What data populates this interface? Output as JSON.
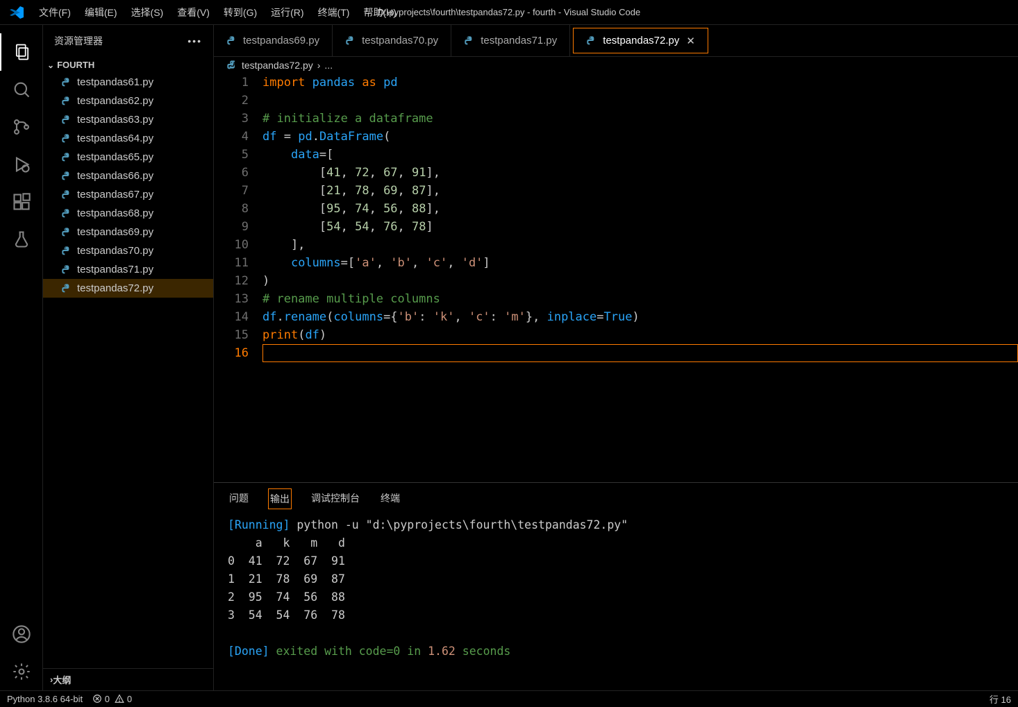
{
  "window_title": "D:\\pyprojects\\fourth\\testpandas72.py - fourth - Visual Studio Code",
  "menu": [
    "文件(F)",
    "编辑(E)",
    "选择(S)",
    "查看(V)",
    "转到(G)",
    "运行(R)",
    "终端(T)",
    "帮助(H)"
  ],
  "sidebar": {
    "header": "资源管理器",
    "section": "FOURTH",
    "outline": "大纲",
    "files": [
      "testpandas61.py",
      "testpandas62.py",
      "testpandas63.py",
      "testpandas64.py",
      "testpandas65.py",
      "testpandas66.py",
      "testpandas67.py",
      "testpandas68.py",
      "testpandas69.py",
      "testpandas70.py",
      "testpandas71.py",
      "testpandas72.py"
    ],
    "selected": 11
  },
  "tabs": {
    "items": [
      "testpandas69.py",
      "testpandas70.py",
      "testpandas71.py",
      "testpandas72.py"
    ],
    "active": 3
  },
  "breadcrumb": {
    "file": "testpandas72.py",
    "tail": "..."
  },
  "code": {
    "cursor_line": 16,
    "tokens": [
      [
        [
          "kw",
          "import"
        ],
        [
          "pl",
          " "
        ],
        [
          "id",
          "pandas"
        ],
        [
          "pl",
          " "
        ],
        [
          "kw",
          "as"
        ],
        [
          "pl",
          " "
        ],
        [
          "id",
          "pd"
        ]
      ],
      [],
      [
        [
          "cm",
          "# initialize a dataframe"
        ]
      ],
      [
        [
          "id",
          "df"
        ],
        [
          "pl",
          " = "
        ],
        [
          "id",
          "pd"
        ],
        [
          "pl",
          "."
        ],
        [
          "id",
          "DataFrame"
        ],
        [
          "pl",
          "("
        ]
      ],
      [
        [
          "pl",
          "    "
        ],
        [
          "id",
          "data"
        ],
        [
          "pl",
          "=["
        ]
      ],
      [
        [
          "pl",
          "        ["
        ],
        [
          "num",
          "41"
        ],
        [
          "pl",
          ", "
        ],
        [
          "num",
          "72"
        ],
        [
          "pl",
          ", "
        ],
        [
          "num",
          "67"
        ],
        [
          "pl",
          ", "
        ],
        [
          "num",
          "91"
        ],
        [
          "pl",
          "],"
        ]
      ],
      [
        [
          "pl",
          "        ["
        ],
        [
          "num",
          "21"
        ],
        [
          "pl",
          ", "
        ],
        [
          "num",
          "78"
        ],
        [
          "pl",
          ", "
        ],
        [
          "num",
          "69"
        ],
        [
          "pl",
          ", "
        ],
        [
          "num",
          "87"
        ],
        [
          "pl",
          "],"
        ]
      ],
      [
        [
          "pl",
          "        ["
        ],
        [
          "num",
          "95"
        ],
        [
          "pl",
          ", "
        ],
        [
          "num",
          "74"
        ],
        [
          "pl",
          ", "
        ],
        [
          "num",
          "56"
        ],
        [
          "pl",
          ", "
        ],
        [
          "num",
          "88"
        ],
        [
          "pl",
          "],"
        ]
      ],
      [
        [
          "pl",
          "        ["
        ],
        [
          "num",
          "54"
        ],
        [
          "pl",
          ", "
        ],
        [
          "num",
          "54"
        ],
        [
          "pl",
          ", "
        ],
        [
          "num",
          "76"
        ],
        [
          "pl",
          ", "
        ],
        [
          "num",
          "78"
        ],
        [
          "pl",
          "]"
        ]
      ],
      [
        [
          "pl",
          "    ],"
        ]
      ],
      [
        [
          "pl",
          "    "
        ],
        [
          "id",
          "columns"
        ],
        [
          "pl",
          "=["
        ],
        [
          "str",
          "'a'"
        ],
        [
          "pl",
          ", "
        ],
        [
          "str",
          "'b'"
        ],
        [
          "pl",
          ", "
        ],
        [
          "str",
          "'c'"
        ],
        [
          "pl",
          ", "
        ],
        [
          "str",
          "'d'"
        ],
        [
          "pl",
          "]"
        ]
      ],
      [
        [
          "pl",
          ")"
        ]
      ],
      [
        [
          "cm",
          "# rename multiple columns"
        ]
      ],
      [
        [
          "id",
          "df"
        ],
        [
          "pl",
          "."
        ],
        [
          "id",
          "rename"
        ],
        [
          "pl",
          "("
        ],
        [
          "id",
          "columns"
        ],
        [
          "pl",
          "={"
        ],
        [
          "str",
          "'b'"
        ],
        [
          "pl",
          ": "
        ],
        [
          "str",
          "'k'"
        ],
        [
          "pl",
          ", "
        ],
        [
          "str",
          "'c'"
        ],
        [
          "pl",
          ": "
        ],
        [
          "str",
          "'m'"
        ],
        [
          "pl",
          "}, "
        ],
        [
          "id",
          "inplace"
        ],
        [
          "pl",
          "="
        ],
        [
          "const",
          "True"
        ],
        [
          "pl",
          ")"
        ]
      ],
      [
        [
          "kw",
          "print"
        ],
        [
          "pl",
          "("
        ],
        [
          "id",
          "df"
        ],
        [
          "pl",
          ")"
        ]
      ],
      []
    ]
  },
  "panel": {
    "tabs": [
      "问题",
      "输出",
      "调试控制台",
      "终端"
    ],
    "active": 1,
    "output": {
      "running_label": "[Running]",
      "running_cmd": " python -u \"d:\\pyprojects\\fourth\\testpandas72.py\"",
      "body": "    a   k   m   d\n0  41  72  67  91\n1  21  78  69  87\n2  95  74  56  88\n3  54  54  76  78",
      "done_label": "[Done]",
      "done_a": " exited with ",
      "done_code": "code=0",
      "done_b": " in ",
      "done_time": "1.62",
      "done_c": " seconds"
    }
  },
  "status": {
    "python": "Python 3.8.6 64-bit",
    "problems": "0",
    "warnings": "0",
    "line": "行 16"
  }
}
